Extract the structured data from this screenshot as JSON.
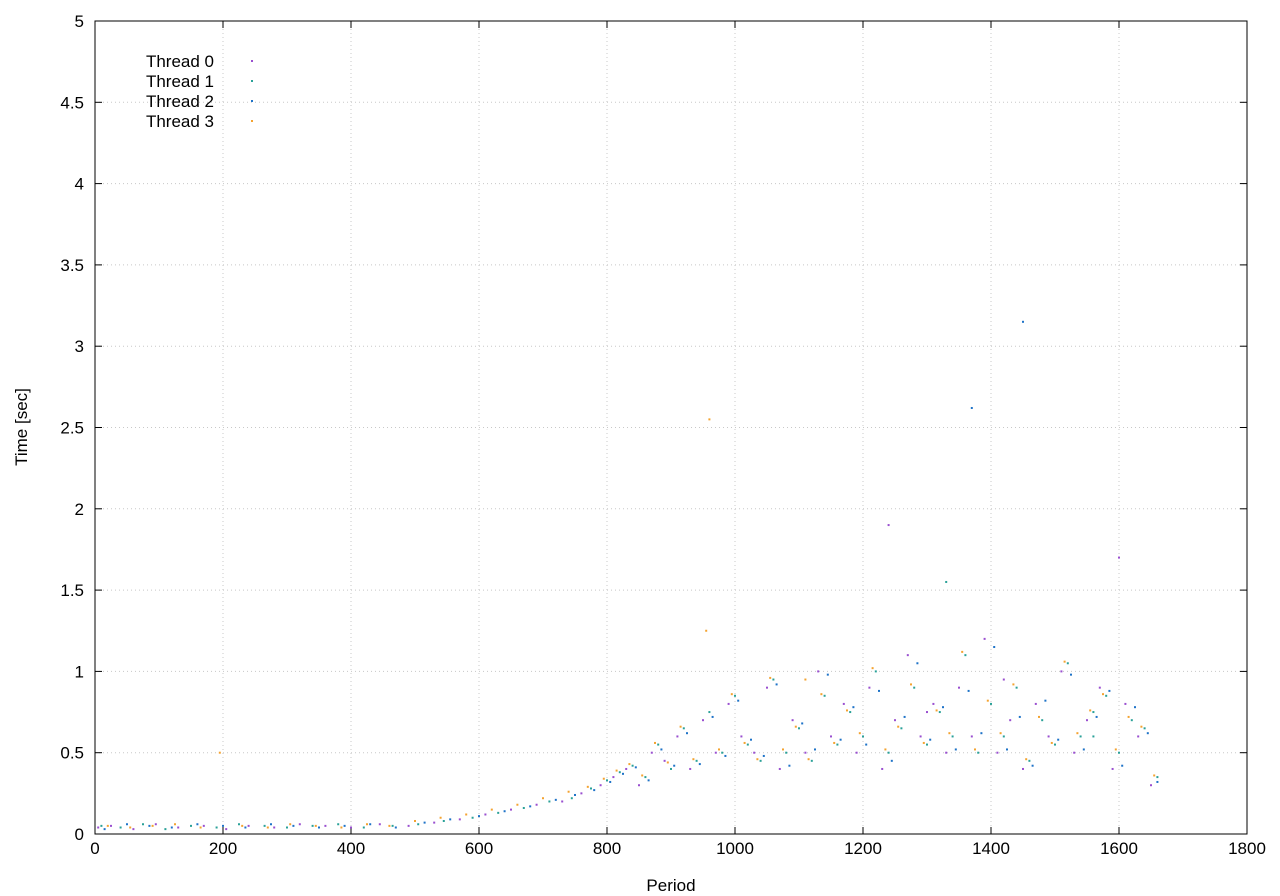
{
  "chart_data": {
    "type": "scatter",
    "title": "",
    "xlabel": "Period",
    "ylabel": "Time [sec]",
    "xlim": [
      0,
      1800
    ],
    "ylim": [
      0,
      5
    ],
    "xticks": [
      "0",
      "200",
      "400",
      "600",
      "800",
      "1000",
      "1200",
      "1400",
      "1600",
      "1800"
    ],
    "yticks": [
      "0",
      "0.5",
      "1",
      "1.5",
      "2",
      "2.5",
      "3",
      "3.5",
      "4",
      "4.5",
      "5"
    ],
    "grid": true,
    "legend_position": "top-left",
    "series": [
      {
        "name": "Thread 0",
        "color": "#9a4fd0",
        "x": [
          5,
          25,
          60,
          95,
          130,
          170,
          205,
          240,
          280,
          320,
          360,
          400,
          445,
          490,
          530,
          570,
          610,
          650,
          690,
          730,
          760,
          790,
          810,
          830,
          850,
          870,
          890,
          910,
          930,
          950,
          970,
          990,
          1010,
          1030,
          1050,
          1070,
          1090,
          1110,
          1130,
          1150,
          1170,
          1190,
          1210,
          1230,
          1250,
          1270,
          1290,
          1310,
          1330,
          1350,
          1370,
          1390,
          1410,
          1430,
          1450,
          1470,
          1490,
          1510,
          1530,
          1550,
          1570,
          1590,
          1610,
          1630,
          1650,
          1240,
          1420,
          1600,
          1300
        ],
        "y": [
          0.04,
          0.05,
          0.03,
          0.06,
          0.04,
          0.05,
          0.03,
          0.05,
          0.04,
          0.06,
          0.05,
          0.04,
          0.06,
          0.05,
          0.07,
          0.09,
          0.12,
          0.15,
          0.18,
          0.2,
          0.25,
          0.3,
          0.35,
          0.4,
          0.3,
          0.5,
          0.45,
          0.6,
          0.4,
          0.7,
          0.5,
          0.8,
          0.6,
          0.5,
          0.9,
          0.4,
          0.7,
          0.5,
          1.0,
          0.6,
          0.8,
          0.5,
          0.9,
          0.4,
          0.7,
          1.1,
          0.6,
          0.8,
          0.5,
          0.9,
          0.6,
          1.2,
          0.5,
          0.7,
          0.4,
          0.8,
          0.6,
          1.0,
          0.5,
          0.7,
          0.9,
          0.4,
          0.8,
          0.6,
          0.3,
          1.9,
          0.95,
          1.7,
          0.75
        ]
      },
      {
        "name": "Thread 1",
        "color": "#2aa198",
        "x": [
          10,
          40,
          75,
          110,
          150,
          190,
          225,
          265,
          300,
          340,
          380,
          420,
          465,
          505,
          545,
          590,
          630,
          670,
          710,
          745,
          775,
          800,
          820,
          840,
          860,
          880,
          900,
          920,
          940,
          960,
          980,
          1000,
          1020,
          1040,
          1060,
          1080,
          1100,
          1120,
          1140,
          1160,
          1180,
          1200,
          1220,
          1240,
          1260,
          1280,
          1300,
          1320,
          1340,
          1360,
          1380,
          1400,
          1420,
          1440,
          1460,
          1480,
          1500,
          1520,
          1540,
          1560,
          1580,
          1600,
          1620,
          1640,
          1660,
          1330,
          1560
        ],
        "y": [
          0.05,
          0.04,
          0.06,
          0.03,
          0.05,
          0.04,
          0.06,
          0.05,
          0.04,
          0.05,
          0.06,
          0.04,
          0.05,
          0.06,
          0.08,
          0.1,
          0.13,
          0.16,
          0.2,
          0.22,
          0.28,
          0.33,
          0.38,
          0.42,
          0.35,
          0.55,
          0.4,
          0.65,
          0.45,
          0.75,
          0.5,
          0.85,
          0.55,
          0.45,
          0.95,
          0.5,
          0.65,
          0.45,
          0.85,
          0.55,
          0.75,
          0.6,
          1.0,
          0.5,
          0.65,
          0.9,
          0.55,
          0.75,
          0.6,
          1.1,
          0.5,
          0.8,
          0.6,
          0.9,
          0.45,
          0.7,
          0.55,
          1.05,
          0.6,
          0.75,
          0.85,
          0.5,
          0.7,
          0.65,
          0.35,
          1.55,
          0.6
        ]
      },
      {
        "name": "Thread 2",
        "color": "#1e73c8",
        "x": [
          15,
          50,
          85,
          120,
          160,
          200,
          235,
          275,
          310,
          350,
          390,
          430,
          470,
          515,
          555,
          600,
          640,
          680,
          720,
          750,
          780,
          805,
          825,
          845,
          865,
          885,
          905,
          925,
          945,
          965,
          985,
          1005,
          1025,
          1045,
          1065,
          1085,
          1105,
          1125,
          1145,
          1165,
          1185,
          1205,
          1225,
          1245,
          1265,
          1285,
          1305,
          1325,
          1345,
          1365,
          1385,
          1405,
          1425,
          1445,
          1465,
          1485,
          1505,
          1525,
          1545,
          1565,
          1585,
          1605,
          1625,
          1645,
          1660,
          1450,
          1370
        ],
        "y": [
          0.03,
          0.06,
          0.05,
          0.04,
          0.06,
          0.05,
          0.04,
          0.06,
          0.05,
          0.04,
          0.05,
          0.06,
          0.04,
          0.07,
          0.09,
          0.11,
          0.14,
          0.17,
          0.21,
          0.24,
          0.27,
          0.32,
          0.37,
          0.41,
          0.33,
          0.52,
          0.42,
          0.62,
          0.43,
          0.72,
          0.48,
          0.82,
          0.58,
          0.48,
          0.92,
          0.42,
          0.68,
          0.52,
          0.98,
          0.58,
          0.78,
          0.55,
          0.88,
          0.45,
          0.72,
          1.05,
          0.58,
          0.78,
          0.52,
          0.88,
          0.62,
          1.15,
          0.52,
          0.72,
          0.42,
          0.82,
          0.58,
          0.98,
          0.52,
          0.72,
          0.88,
          0.42,
          0.78,
          0.62,
          0.32,
          3.15,
          2.62
        ]
      },
      {
        "name": "Thread 3",
        "color": "#f4a330",
        "x": [
          20,
          55,
          90,
          125,
          165,
          195,
          230,
          270,
          305,
          345,
          385,
          425,
          460,
          500,
          540,
          580,
          620,
          660,
          700,
          740,
          770,
          795,
          815,
          835,
          855,
          875,
          895,
          915,
          935,
          955,
          975,
          995,
          1015,
          1035,
          1055,
          1075,
          1095,
          1115,
          1135,
          1155,
          1175,
          1195,
          1215,
          1235,
          1255,
          1275,
          1295,
          1315,
          1335,
          1355,
          1375,
          1395,
          1415,
          1435,
          1455,
          1475,
          1495,
          1515,
          1535,
          1555,
          1575,
          1595,
          1615,
          1635,
          1655,
          960,
          1110
        ],
        "y": [
          0.05,
          0.04,
          0.05,
          0.06,
          0.04,
          0.5,
          0.05,
          0.04,
          0.06,
          0.05,
          0.04,
          0.06,
          0.05,
          0.08,
          0.1,
          0.12,
          0.15,
          0.18,
          0.22,
          0.26,
          0.29,
          0.34,
          0.39,
          0.43,
          0.36,
          0.56,
          0.44,
          0.66,
          0.46,
          1.25,
          0.52,
          0.86,
          0.56,
          0.46,
          0.96,
          0.52,
          0.66,
          0.46,
          0.86,
          0.56,
          0.76,
          0.62,
          1.02,
          0.52,
          0.66,
          0.92,
          0.56,
          0.76,
          0.62,
          1.12,
          0.52,
          0.82,
          0.62,
          0.92,
          0.46,
          0.72,
          0.56,
          1.06,
          0.62,
          0.76,
          0.86,
          0.52,
          0.72,
          0.66,
          0.36,
          2.55,
          0.95
        ]
      }
    ]
  }
}
